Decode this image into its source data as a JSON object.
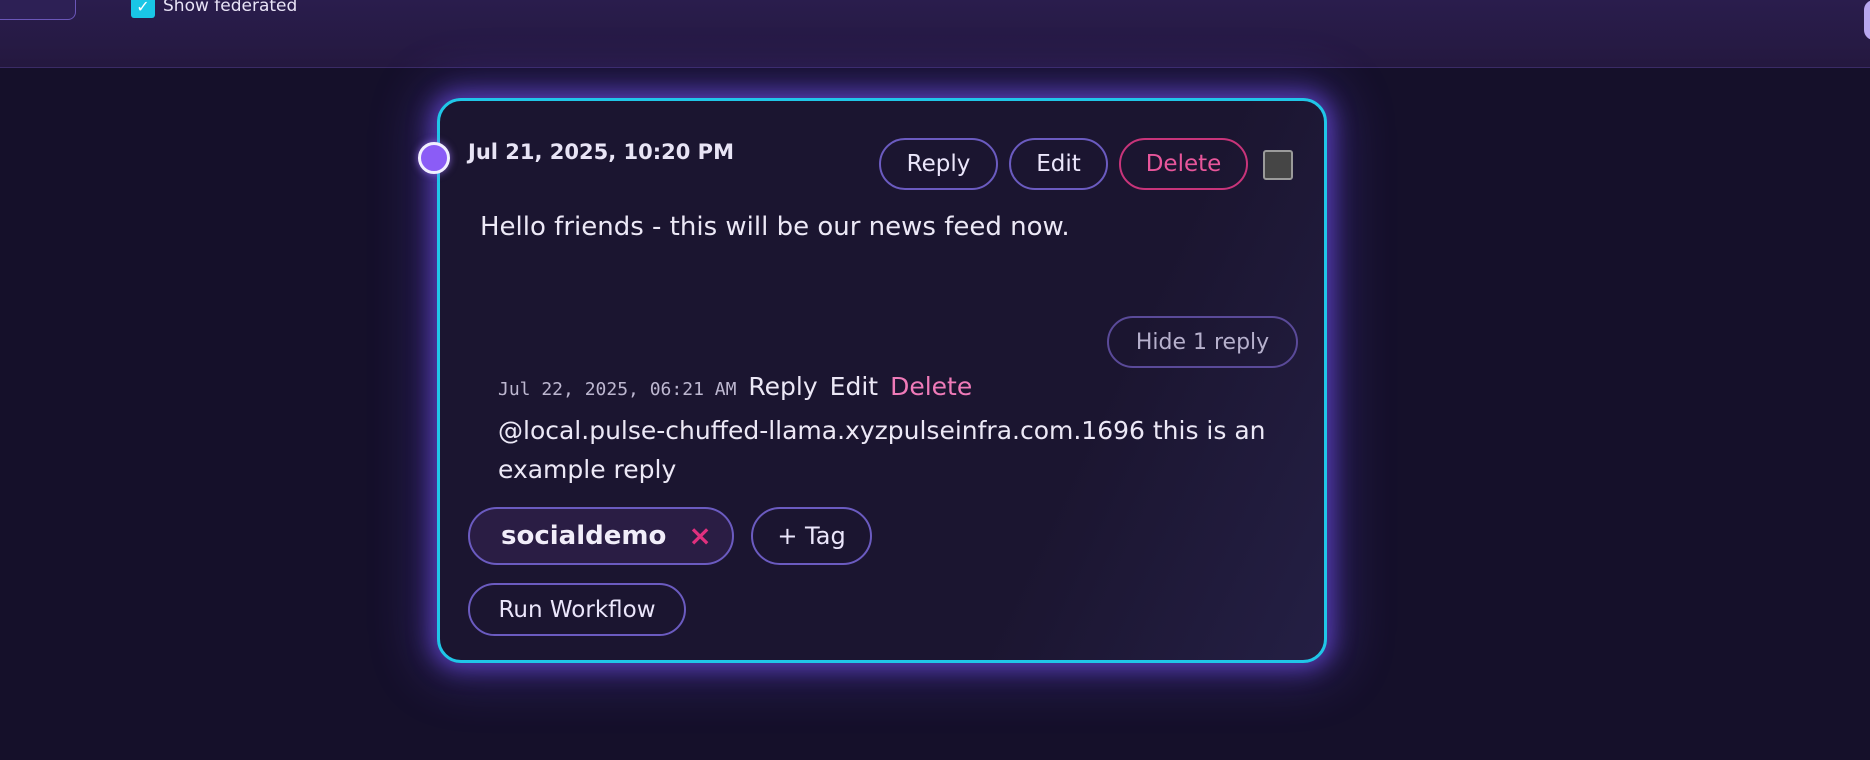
{
  "topbar": {
    "show_federated_label": "Show federated",
    "show_federated_checked": true,
    "check_glyph": "✓"
  },
  "post": {
    "date": "Jul 21, 2025, 10:20 PM",
    "actions": {
      "reply": "Reply",
      "edit": "Edit",
      "delete": "Delete"
    },
    "body": "Hello friends - this will be our news feed now.",
    "hide_replies_label": "Hide 1 reply",
    "reply": {
      "date": "Jul 22, 2025, 06:21 AM",
      "actions": {
        "reply": "Reply",
        "edit": "Edit",
        "delete": "Delete"
      },
      "body": "@local.pulse-chuffed-llama.xyzpulseinfra.com.1696 this is an example reply"
    },
    "tags": [
      {
        "label": "socialdemo",
        "remove_glyph": "×"
      }
    ],
    "add_tag_label": "+ Tag",
    "run_workflow_label": "Run Workflow"
  },
  "colors": {
    "background": "#15102a",
    "card_border": "#20c6e8",
    "accent_purple": "#8b5cf6",
    "delete_pink": "#e8569b"
  }
}
